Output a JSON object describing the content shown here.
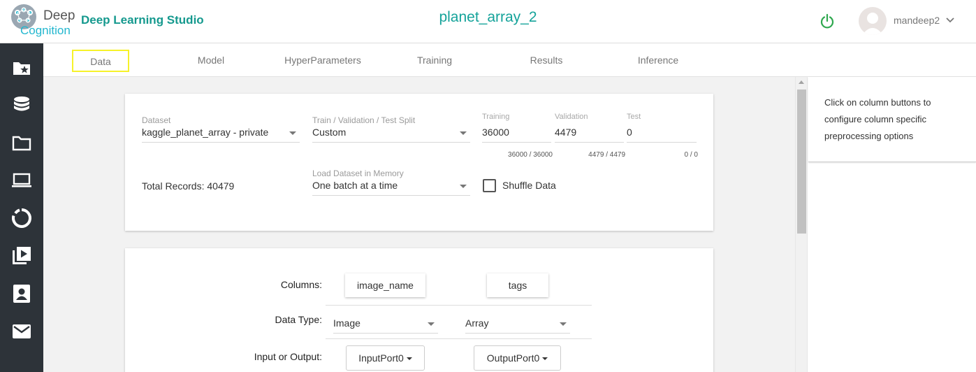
{
  "header": {
    "logo_word1": "Deep",
    "logo_word2": "Cognition",
    "studio_name": "Deep Learning Studio",
    "project_name": "planet_array_2",
    "username": "mandeep2",
    "power_icon": "power-icon",
    "power_color": "#2fa84f"
  },
  "sidebar": {
    "items": [
      {
        "icon": "starred-folder-icon"
      },
      {
        "icon": "database-icon"
      },
      {
        "icon": "folder-icon"
      },
      {
        "icon": "laptop-icon"
      },
      {
        "icon": "donut-chart-icon"
      },
      {
        "icon": "video-library-icon"
      },
      {
        "icon": "contact-card-icon"
      },
      {
        "icon": "mail-icon"
      }
    ]
  },
  "tabs": [
    {
      "label": "Data",
      "active": true
    },
    {
      "label": "Model"
    },
    {
      "label": "HyperParameters"
    },
    {
      "label": "Training"
    },
    {
      "label": "Results"
    },
    {
      "label": "Inference"
    }
  ],
  "dataset_card": {
    "dataset_label": "Dataset",
    "dataset_value": "kaggle_planet_array - private",
    "split_label": "Train / Validation / Test Split",
    "split_value": "Custom",
    "training_label": "Training",
    "training_value": "36000",
    "training_count": "36000 / 36000",
    "validation_label": "Validation",
    "validation_value": "4479",
    "validation_count": "4479 / 4479",
    "test_label": "Test",
    "test_value": "0",
    "test_count": "0 / 0",
    "total_records": "Total Records: 40479",
    "load_label": "Load Dataset in Memory",
    "load_value": "One batch at a time",
    "shuffle_label": "Shuffle Data",
    "shuffle_checked": false
  },
  "columns_card": {
    "columns_label": "Columns:",
    "data_type_label": "Data Type:",
    "io_label": "Input or Output:",
    "columns": [
      {
        "name": "image_name",
        "type": "Image",
        "port": "InputPort0"
      },
      {
        "name": "tags",
        "type": "Array",
        "port": "OutputPort0"
      }
    ]
  },
  "help_panel": {
    "text": "Click on column buttons to configure column specific preprocessing options"
  },
  "colors": {
    "accent": "#15a39a",
    "logo_cyan": "#23b7cf",
    "rail_bg": "#2d3339",
    "active_tab_outline": "#f6f22a"
  }
}
